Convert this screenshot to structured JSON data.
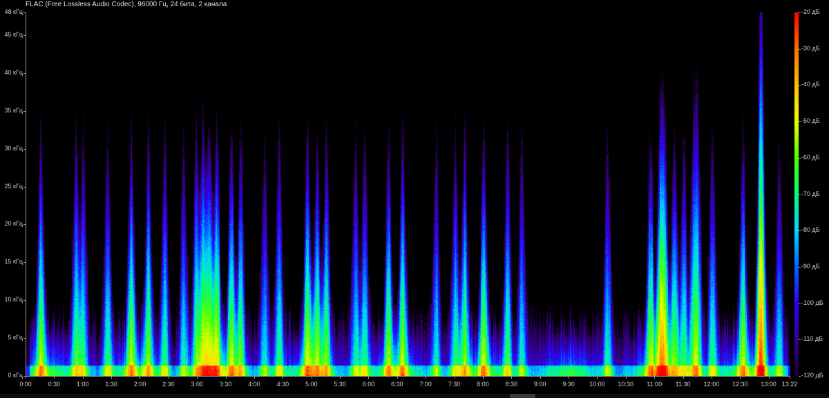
{
  "header": {
    "title": "FLAC (Free Lossless Audio Codec), 96000 Гц, 24 бита, 2 канала"
  },
  "chart_data": {
    "type": "heatmap",
    "title": "FLAC (Free Lossless Audio Codec), 96000 Гц, 24 бита, 2 канала",
    "xlabel": "",
    "ylabel": "",
    "x_tick_labels": [
      "0:00",
      "0:30",
      "1:00",
      "1:30",
      "2:00",
      "2:30",
      "3:00",
      "3:30",
      "4:00",
      "4:30",
      "5:00",
      "5:30",
      "6:00",
      "6:30",
      "7:00",
      "7:30",
      "8:00",
      "8:30",
      "9:00",
      "9:30",
      "10:00",
      "10:30",
      "11:00",
      "11:30",
      "12:00",
      "12:30",
      "13:00",
      "13:22"
    ],
    "x_tick_seconds": [
      0,
      30,
      60,
      90,
      120,
      150,
      180,
      210,
      240,
      270,
      300,
      330,
      360,
      390,
      420,
      450,
      480,
      510,
      540,
      570,
      600,
      630,
      660,
      690,
      720,
      750,
      780,
      802
    ],
    "xlim_seconds": [
      0,
      802
    ],
    "y_tick_labels": [
      "0 кГц",
      "5 кГц",
      "10 кГц",
      "15 кГц",
      "20 кГц",
      "25 кГц",
      "30 кГц",
      "35 кГц",
      "40 кГц",
      "45 кГц",
      "48 кГц"
    ],
    "y_tick_values_khz": [
      0,
      5,
      10,
      15,
      20,
      25,
      30,
      35,
      40,
      45,
      48
    ],
    "ylim_khz": [
      0,
      48
    ],
    "colorbar": {
      "labels": [
        "-20 дБ",
        "-30 дБ",
        "-40 дБ",
        "-50 дБ",
        "-60 дБ",
        "-70 дБ",
        "-80 дБ",
        "-90 дБ",
        "-100 дБ",
        "-110 дБ",
        "-120 дБ"
      ],
      "values_db": [
        -20,
        -30,
        -40,
        -50,
        -60,
        -70,
        -80,
        -90,
        -100,
        -110,
        -120
      ],
      "range_db": [
        -120,
        -20
      ],
      "colors": [
        "#ff0000",
        "#ff7a00",
        "#ffd000",
        "#eaff00",
        "#4cff00",
        "#00ff7a",
        "#00d8ff",
        "#0066ff",
        "#2a00ff",
        "#3a0090",
        "#1a0030"
      ]
    },
    "grid": false,
    "legend": "colorbar-right",
    "peaks_seconds": [
      15,
      52,
      60,
      85,
      110,
      128,
      145,
      165,
      178,
      185,
      192,
      200,
      215,
      225,
      250,
      265,
      295,
      305,
      315,
      345,
      355,
      380,
      395,
      430,
      450,
      460,
      480,
      505,
      520,
      610,
      655,
      665,
      670,
      680,
      690,
      700,
      705,
      720,
      752,
      770,
      772,
      790
    ]
  }
}
